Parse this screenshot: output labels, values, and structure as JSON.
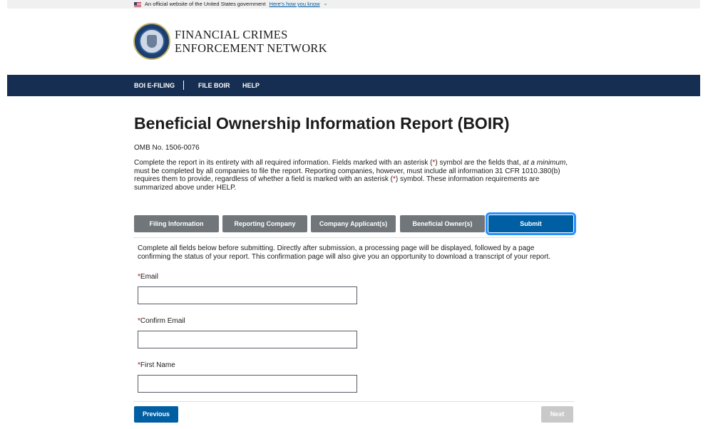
{
  "gov_banner": {
    "text": "An official website of the United States government",
    "link": "Here's how you know"
  },
  "header": {
    "line1": "FINANCIAL CRIMES",
    "line2": "ENFORCEMENT NETWORK"
  },
  "nav": {
    "items": [
      "BOI E-FILING",
      "FILE BOIR",
      "HELP"
    ]
  },
  "page": {
    "title": "Beneficial Ownership Information Report (BOIR)",
    "omb": "OMB No. 1506-0076",
    "intro": {
      "p1": "Complete the report in its entirety with all required information. Fields marked with an asterisk (",
      "asterisk": "*",
      "p2": ") symbol are the fields that, ",
      "emph": "at a minimum",
      "p3": ", must be completed by all companies to file the report. Reporting companies, however, must include all information 31 CFR 1010.380(b) requires them to provide, regardless of whether a field is marked with an asterisk (",
      "p4": ") symbol. These information requirements are summarized above under HELP."
    }
  },
  "tabs": [
    {
      "label": "Filing Information"
    },
    {
      "label": "Reporting Company"
    },
    {
      "label": "Company Applicant(s)"
    },
    {
      "label": "Beneficial Owner(s)"
    },
    {
      "label": "Submit",
      "active": true
    }
  ],
  "submit_panel": {
    "description": "Complete all fields below before submitting. Directly after submission, a processing page will be displayed, followed by a page confirming the status of your report. This confirmation page will also give you an opportunity to download a transcript of your report.",
    "required_marker": "*",
    "fields": [
      {
        "label": "Email",
        "value": ""
      },
      {
        "label": "Confirm Email",
        "value": ""
      },
      {
        "label": "First Name",
        "value": ""
      }
    ]
  },
  "buttons": {
    "previous": "Previous",
    "next": "Next"
  },
  "colors": {
    "navy": "#162e51",
    "primary": "#005ea2",
    "focus": "#2491ff",
    "tab_inactive": "#71767a",
    "disabled": "#c9c9c9",
    "required": "#b50909"
  }
}
